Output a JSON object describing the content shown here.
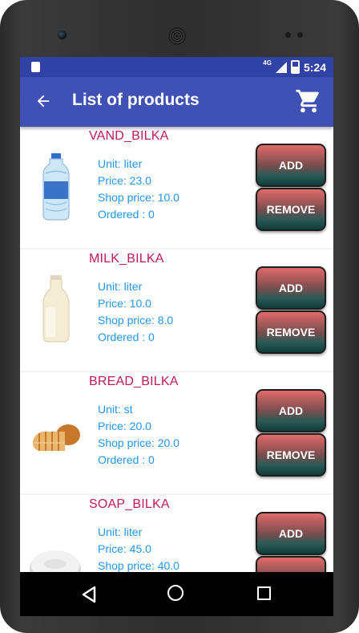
{
  "status_bar": {
    "network": "4G",
    "time": "5:24"
  },
  "app_bar": {
    "title": "List of products",
    "back_icon": "arrow-back-icon",
    "cart_icon": "shopping-cart-icon"
  },
  "colors": {
    "app_bar": "#3f51b5",
    "status_bar": "#3042a6",
    "product_name": "#c2185b",
    "product_info": "#2196f3"
  },
  "products": [
    {
      "name": "VAND_BILKA",
      "unit": "Unit: liter",
      "price": "Price: 23.0",
      "shop_price": "Shop price: 10.0",
      "ordered": "Ordered : 0",
      "image": "water-bottle-image",
      "add_label": "ADD",
      "remove_label": "REMOVE"
    },
    {
      "name": "MILK_BILKA",
      "unit": "Unit: liter",
      "price": "Price: 10.0",
      "shop_price": "Shop price: 8.0",
      "ordered": "Ordered : 0",
      "image": "milk-bottle-image",
      "add_label": "ADD",
      "remove_label": "REMOVE"
    },
    {
      "name": "BREAD_BILKA",
      "unit": "Unit: st",
      "price": "Price: 20.0",
      "shop_price": "Shop price: 20.0",
      "ordered": "Ordered : 0",
      "image": "bread-loaf-image",
      "add_label": "ADD",
      "remove_label": "REMOVE"
    },
    {
      "name": "SOAP_BILKA",
      "unit": "Unit: liter",
      "price": "Price: 45.0",
      "shop_price": "Shop price: 40.0",
      "image": "soap-bar-image",
      "add_label": "ADD"
    }
  ],
  "nav_bar": {
    "back": "nav-back-icon",
    "home": "nav-home-icon",
    "recents": "nav-recents-icon"
  }
}
